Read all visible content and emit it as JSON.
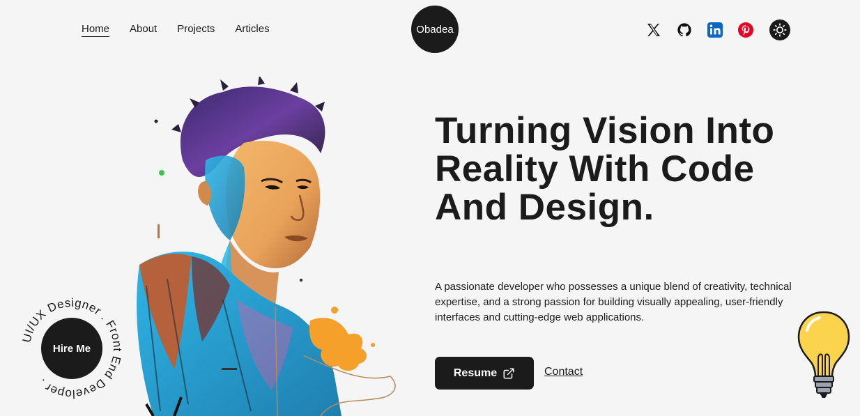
{
  "nav": {
    "links": [
      {
        "label": "Home",
        "active": true
      },
      {
        "label": "About",
        "active": false
      },
      {
        "label": "Projects",
        "active": false
      },
      {
        "label": "Articles",
        "active": false
      }
    ],
    "logo": "Obadea",
    "socials": [
      "x-icon",
      "github-icon",
      "linkedin-icon",
      "pinterest-icon"
    ],
    "theme_toggle": "sun-icon"
  },
  "hero": {
    "headline": "Turning Vision Into Reality With Code And Design.",
    "intro": "A passionate developer who possesses a unique blend of creativity, technical expertise, and a strong passion for building visually appealing, user-friendly interfaces and cutting-edge web applications.",
    "resume_label": "Resume",
    "contact_label": "Contact"
  },
  "badge": {
    "button_label": "Hire Me",
    "ring_text": "UI/UX Designer . Front End Developer ."
  },
  "colors": {
    "background": "#f5f5f5",
    "dark": "#1b1b1b",
    "linkedin": "#0a66c2",
    "pinterest": "#e60023",
    "bulb": "#fcd34d"
  }
}
